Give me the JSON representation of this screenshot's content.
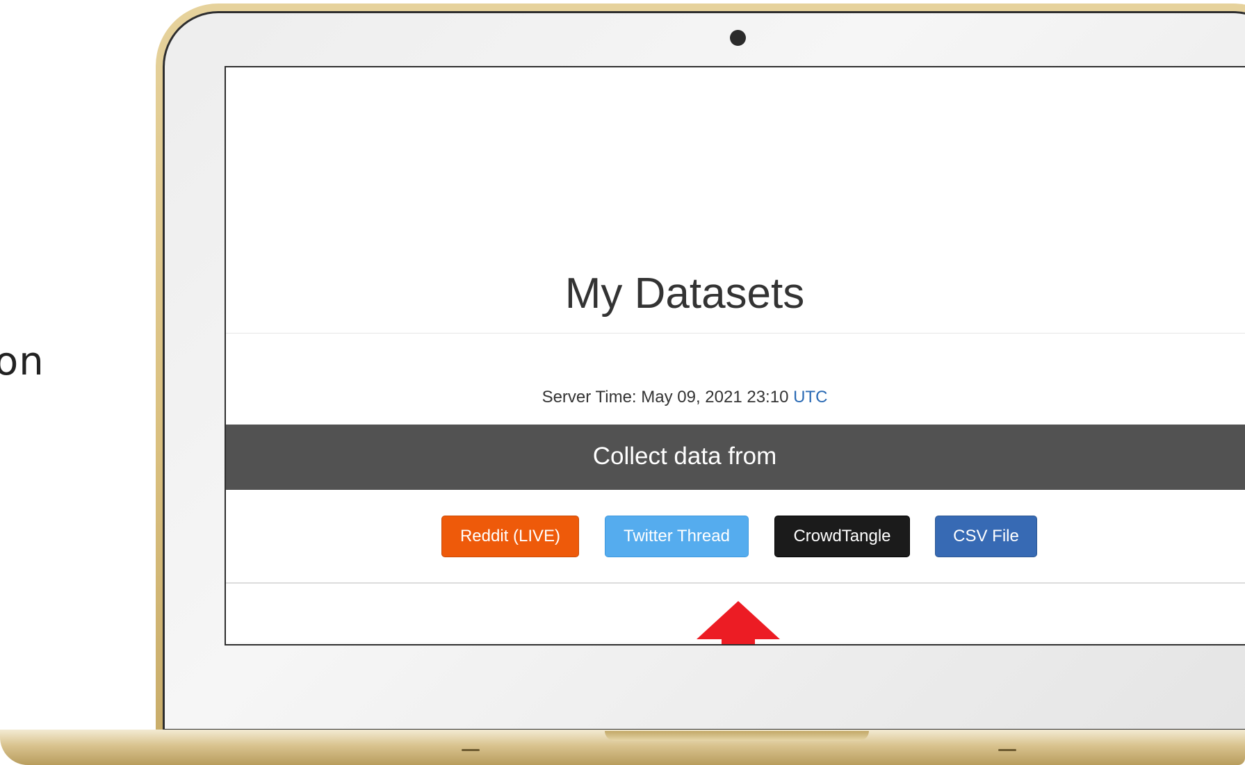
{
  "side_text": "on",
  "page": {
    "title": "My Datasets",
    "server_time_label": "Server Time: May 09, 2021 23:10",
    "timezone": "UTC",
    "collect_heading": "Collect data from"
  },
  "sources": {
    "reddit": "Reddit (LIVE)",
    "twitter": "Twitter Thread",
    "crowdtangle": "CrowdTangle",
    "csv": "CSV File"
  },
  "colors": {
    "reddit": "#ee5a0a",
    "twitter": "#55acee",
    "crowdtangle": "#1b1b1b",
    "csv": "#376ab4",
    "collect_bar": "#525252",
    "arrow": "#ec1c24",
    "laptop_frame": "#dac07f"
  },
  "icons": {
    "annotation": "red-up-arrow"
  }
}
